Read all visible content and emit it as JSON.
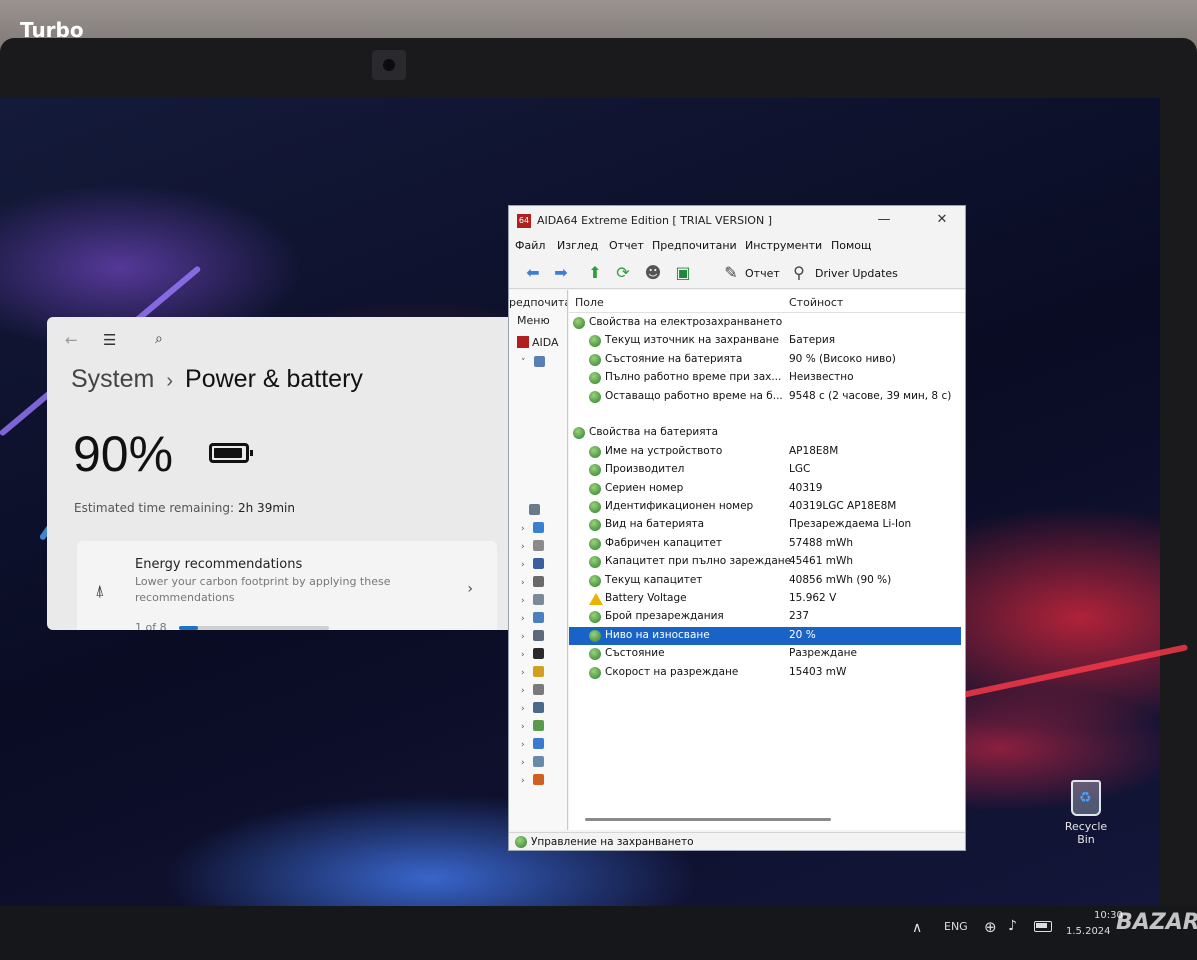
{
  "photo_label": "Turbo",
  "settings": {
    "breadcrumb_parent": "System",
    "breadcrumb_sep": "›",
    "breadcrumb_current": "Power & battery",
    "battery_percent": "90%",
    "estimated_label": "Estimated time remaining:",
    "estimated_value": "2h 39min",
    "energy": {
      "title": "Energy recommendations",
      "description": "Lower your carbon footprint by applying these recommendations",
      "pager": "1 of 8",
      "progress_fraction": 0.125
    }
  },
  "aida": {
    "window_title": "AIDA64 Extreme Edition  [ TRIAL VERSION ]",
    "menu": [
      "Файл",
      "Изглед",
      "Отчет",
      "Предпочитани",
      "Инструменти",
      "Помощ"
    ],
    "toolbar_report": "Отчет",
    "toolbar_driver_updates": "Driver Updates",
    "left_header": "редпочита",
    "left_menu": "Меню",
    "left_root": "AIDA",
    "col_field": "Поле",
    "col_value": "Стойност",
    "rows": [
      {
        "field": "Свойства на електрозахранването",
        "value": "",
        "group": true
      },
      {
        "field": "Текущ източник на захранване",
        "value": "Батерия"
      },
      {
        "field": "Състояние на батерията",
        "value": "90 % (Високо ниво)"
      },
      {
        "field": "Пълно работно време при зах...",
        "value": "Неизвестно"
      },
      {
        "field": "Оставащо работно време на б...",
        "value": "9548 с (2 часове, 39 мин, 8 с)"
      },
      {
        "field": "",
        "value": "",
        "blank": true
      },
      {
        "field": "Свойства на батерията",
        "value": "",
        "group": true
      },
      {
        "field": "Име на устройството",
        "value": "AP18E8M"
      },
      {
        "field": "Производител",
        "value": "LGC"
      },
      {
        "field": "Сериен номер",
        "value": "40319"
      },
      {
        "field": "Идентификационен номер",
        "value": "40319LGC AP18E8M"
      },
      {
        "field": "Вид на батерията",
        "value": "Презареждаема Li-Ion"
      },
      {
        "field": "Фабричен капацитет",
        "value": "57488 mWh"
      },
      {
        "field": "Капацитет при пълно зареждане",
        "value": "45461 mWh"
      },
      {
        "field": "Текущ капацитет",
        "value": "40856 mWh  (90 %)"
      },
      {
        "field": "Battery Voltage",
        "value": "15.962 V",
        "warn": true
      },
      {
        "field": "Брой презареждания",
        "value": "237"
      },
      {
        "field": "Ниво на износване",
        "value": "20 %",
        "selected": true
      },
      {
        "field": "Състояние",
        "value": "Разреждане"
      },
      {
        "field": "Скорост на разреждане",
        "value": "15403 mW"
      }
    ],
    "status_text": "Управление на захранването"
  },
  "desktop": {
    "recycle_bin": "Recycle Bin"
  },
  "taskbar": {
    "lang": "ENG",
    "time": "10:30",
    "date": "1.5.2024"
  },
  "watermark": "BAZAR"
}
